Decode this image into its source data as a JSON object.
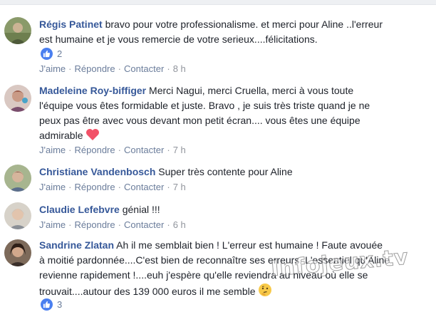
{
  "ui": {
    "actions": {
      "like": "J'aime",
      "reply": "Répondre",
      "contact": "Contacter",
      "sep": "·"
    }
  },
  "comments": [
    {
      "author": "Régis Patinet",
      "text_lines": [
        "bravo pour votre professionalisme. et merci pour Aline ..l'erreur",
        "est humaine et je vous remercie de votre serieux....félicitations."
      ],
      "reactions": "2",
      "time": "8 h"
    },
    {
      "author": "Madeleine Roy-biffiger",
      "text_lines": [
        "Merci Nagui, merci Cruella, merci à vous toute",
        "l'équipe vous êtes formidable et juste. Bravo , je suis très triste quand je ne",
        "peux pas être avec vous devant mon petit écran.... vous êtes une équipe",
        "admirable"
      ],
      "emoji": "heart-emoji",
      "time": "7 h"
    },
    {
      "author": "Christiane Vandenbosch",
      "text_lines": [
        "Super très contente pour Aline"
      ],
      "time": "7 h"
    },
    {
      "author": "Claudie Lefebvre",
      "text_lines": [
        "génial !!!"
      ],
      "time": "6 h"
    },
    {
      "author": "Sandrine Zlatan",
      "text_lines": [
        "Ah il me semblait bien ! L'erreur est humaine ! Faute avouée",
        "à moitié pardonnée....C'est bien de reconnaître ses erreurs. L'essentiel qu'Aline",
        "revienne rapidement !....euh j'espère qu'elle reviendra au niveau où elle se",
        "trouvait....autour des 139 000 euros il me semble"
      ],
      "emoji": "thinking-emoji",
      "reactions": "3"
    }
  ],
  "watermark": "Infojeux.tv",
  "colors": {
    "author": "#365899",
    "action": "#6b7d9b",
    "like_badge": "#4a7ff0",
    "heart": "#f25268"
  }
}
